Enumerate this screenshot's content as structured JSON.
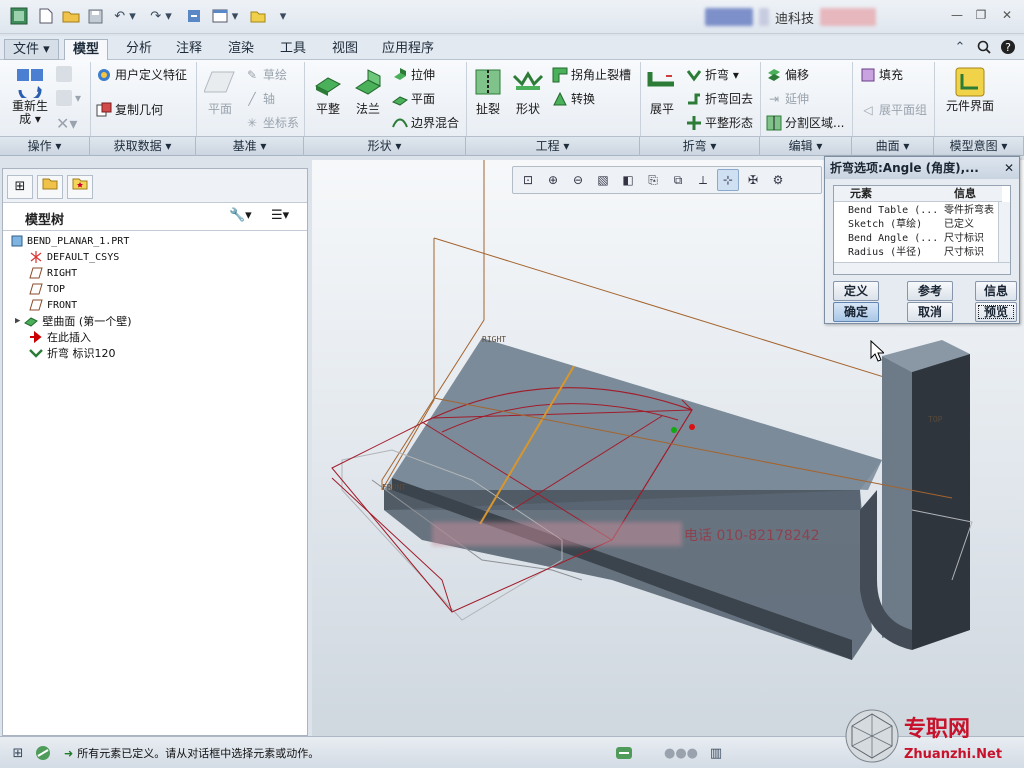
{
  "window": {
    "title_fragment": "迪科技",
    "controls": [
      "—",
      "❐",
      "✕"
    ]
  },
  "quick_access": {
    "icons": [
      "app-logo-icon",
      "new-icon",
      "open-icon",
      "save-icon",
      "undo-icon",
      "redo-icon",
      "regenerate-icon",
      "windows-icon",
      "close-window-icon",
      "customize-icon"
    ]
  },
  "tabs": [
    {
      "label": "文件 ▾"
    },
    {
      "label": "模型"
    },
    {
      "label": "分析"
    },
    {
      "label": "注释"
    },
    {
      "label": "渲染"
    },
    {
      "label": "工具"
    },
    {
      "label": "视图"
    },
    {
      "label": "应用程序"
    }
  ],
  "ribbon": {
    "operations": {
      "regenerate": "重新生成 ▾",
      "group": "操作 ▾"
    },
    "get_data": {
      "udf": "用户定义特征",
      "copy_geom": "复制几何",
      "group": "获取数据 ▾"
    },
    "datum": {
      "plane": "平面",
      "sketch": "草绘",
      "axis": "轴",
      "csys": "坐标系",
      "group": "基准 ▾"
    },
    "shapes": {
      "flat": "平整",
      "flange": "法兰",
      "extrude": "拉伸",
      "planar": "平面",
      "boundary_blend": "边界混合",
      "group": "形状 ▾"
    },
    "engineering": {
      "rip": "扯裂",
      "form": "形状",
      "corner_relief": "拐角止裂槽",
      "convert": "转换",
      "group": "工程 ▾"
    },
    "bends": {
      "unbend": "展平",
      "bend": "折弯 ▾",
      "bend_back": "折弯回去",
      "flat_state": "平整形态",
      "group": "折弯 ▾"
    },
    "editing": {
      "offset": "偏移",
      "extend": "延伸",
      "split_area": "分割区域...",
      "group": "编辑 ▾"
    },
    "surfaces": {
      "fill": "填充",
      "flat_pattern": "展平面组",
      "group": "曲面 ▾"
    },
    "design_intent": {
      "part_interface": "元件界面",
      "group": "模型意图 ▾"
    }
  },
  "model_tree": {
    "title": "模型树",
    "items": [
      {
        "text": "BEND_PLANAR_1.PRT"
      },
      {
        "text": "DEFAULT_CSYS"
      },
      {
        "text": "RIGHT"
      },
      {
        "text": "TOP"
      },
      {
        "text": "FRONT"
      },
      {
        "text": "壁曲面 (第一个壁)"
      },
      {
        "text": "在此插入"
      },
      {
        "text": "折弯 标识120"
      }
    ]
  },
  "viewport": {
    "datum_labels": {
      "right": "RIGHT",
      "front": "FRONT",
      "top": "TOP"
    },
    "watermark_text": "专职网",
    "watermark_url": "Zhuanzhi.Net",
    "overlay_text": "电话 010-82178242",
    "colors": {
      "part_fill": "#7c8b99",
      "part_dark": "#3d4650",
      "sketch": "#a11c2a",
      "datum_plane": "#a4642e"
    }
  },
  "dialog": {
    "title": "折弯选项:Angle (角度),...",
    "columns": [
      "元素",
      "信息"
    ],
    "rows": [
      {
        "element": "Bend Table (...",
        "info": "零件折弯表"
      },
      {
        "element": "Sketch (草绘)",
        "info": "已定义"
      },
      {
        "element": "Bend Angle (...",
        "info": "尺寸标识"
      },
      {
        "element": "Radius (半径)",
        "info": "尺寸标识"
      }
    ],
    "buttons": {
      "define": "定义",
      "refs": "参考",
      "info": "信息",
      "ok": "确定",
      "cancel": "取消",
      "preview": "预览"
    }
  },
  "status": {
    "message": "所有元素已定义。请从对话框中选择元素或动作。"
  }
}
